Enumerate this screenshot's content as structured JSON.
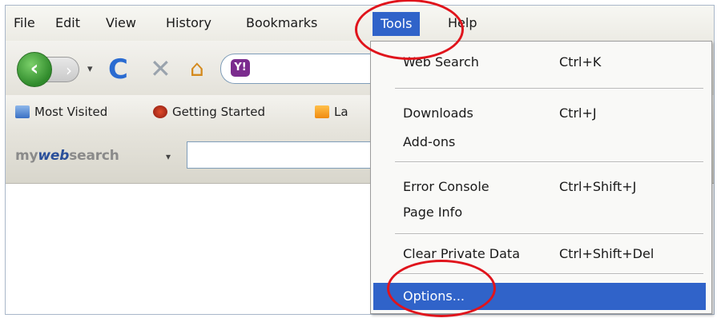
{
  "menubar": {
    "items": [
      {
        "label": "File"
      },
      {
        "label": "Edit"
      },
      {
        "label": "View"
      },
      {
        "label": "History"
      },
      {
        "label": "Bookmarks"
      },
      {
        "label": "Tools"
      },
      {
        "label": "Help"
      }
    ]
  },
  "navbar": {
    "back_glyph": "‹",
    "forward_glyph": "›",
    "history_dropdown_glyph": "▾",
    "reload_glyph": "C",
    "stop_glyph": "✕",
    "home_glyph": "⌂",
    "address_icon_text": "Y!"
  },
  "bookmarks": {
    "items": [
      {
        "label": "Most Visited"
      },
      {
        "label": "Getting Started"
      },
      {
        "label": "La"
      }
    ]
  },
  "searchbar": {
    "logo_my": "my",
    "logo_web": "web",
    "logo_search": "search",
    "dropdown_glyph": "▾"
  },
  "tools_menu": {
    "items": [
      {
        "label": "Web Search",
        "shortcut": "Ctrl+K"
      },
      {
        "label": "Downloads",
        "shortcut": "Ctrl+J"
      },
      {
        "label": "Add-ons",
        "shortcut": ""
      },
      {
        "label": "Error Console",
        "shortcut": "Ctrl+Shift+J"
      },
      {
        "label": "Page Info",
        "shortcut": ""
      },
      {
        "label": "Clear Private Data",
        "shortcut": "Ctrl+Shift+Del"
      },
      {
        "label": "Options...",
        "shortcut": ""
      }
    ]
  },
  "colors": {
    "highlight": "#3063c9",
    "annotation_ring": "#e0141c"
  }
}
